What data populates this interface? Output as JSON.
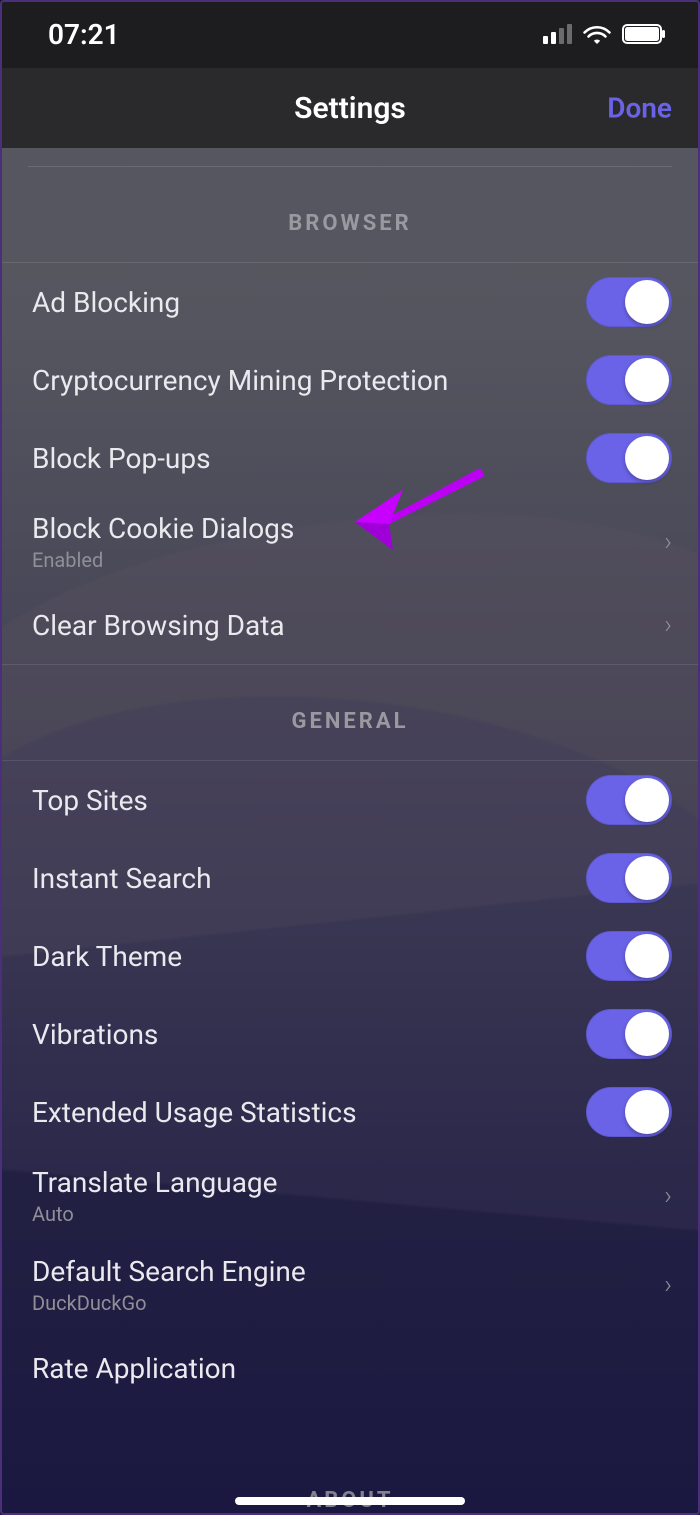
{
  "status": {
    "time": "07:21"
  },
  "nav": {
    "title": "Settings",
    "done": "Done"
  },
  "sections": {
    "browser_header": "BROWSER",
    "general_header": "GENERAL",
    "about_header": "ABOUT"
  },
  "browser": {
    "ad_blocking": {
      "label": "Ad Blocking",
      "on": true
    },
    "crypto_mining": {
      "label": "Cryptocurrency Mining Protection",
      "on": true
    },
    "block_popups": {
      "label": "Block Pop-ups",
      "on": true
    },
    "block_cookie_dialogs": {
      "label": "Block Cookie Dialogs",
      "sub": "Enabled"
    },
    "clear_browsing_data": {
      "label": "Clear Browsing Data"
    }
  },
  "general": {
    "top_sites": {
      "label": "Top Sites",
      "on": true
    },
    "instant_search": {
      "label": "Instant Search",
      "on": true
    },
    "dark_theme": {
      "label": "Dark Theme",
      "on": true
    },
    "vibrations": {
      "label": "Vibrations",
      "on": true
    },
    "extended_stats": {
      "label": "Extended Usage Statistics",
      "on": true
    },
    "translate_lang": {
      "label": "Translate Language",
      "sub": "Auto"
    },
    "default_search": {
      "label": "Default Search Engine",
      "sub": "DuckDuckGo"
    },
    "rate_app": {
      "label": "Rate Application"
    }
  },
  "annotation": {
    "arrow_target": "block_cookie_dialogs",
    "color": "#c800ff"
  }
}
